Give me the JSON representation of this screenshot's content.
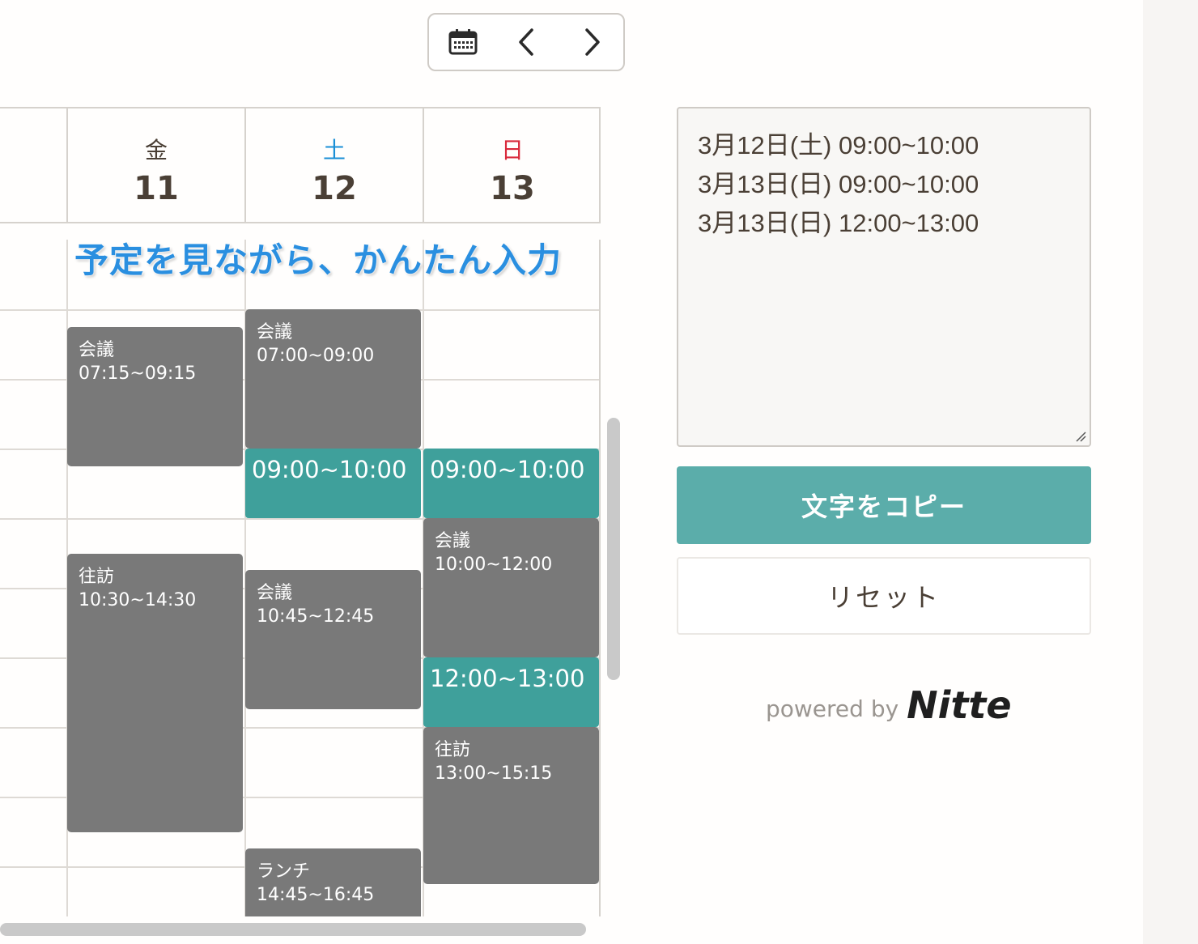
{
  "toolbar": {
    "calendar_icon": "calendar-icon",
    "prev_icon": "chevron-left-icon",
    "next_icon": "chevron-right-icon"
  },
  "days": [
    {
      "dow": "金",
      "date": "11",
      "color": "#4a3f35"
    },
    {
      "dow": "土",
      "date": "12",
      "color": "#1a8fd6"
    },
    {
      "dow": "日",
      "date": "13",
      "color": "#d9293b"
    }
  ],
  "banner": "予定を見ながら、かんたん入力",
  "events": {
    "fri_meeting": {
      "title": "会議",
      "time": "07:15~09:15"
    },
    "fri_visit": {
      "title": "往訪",
      "time": "10:30~14:30"
    },
    "sat_meeting1": {
      "title": "会議",
      "time": "07:00~09:00"
    },
    "sat_meeting2": {
      "title": "会議",
      "time": "10:45~12:45"
    },
    "sat_lunch": {
      "title": "ランチ",
      "time": "14:45~16:45"
    },
    "sun_meeting": {
      "title": "会議",
      "time": "10:00~12:00"
    },
    "sun_visit": {
      "title": "往訪",
      "time": "13:00~15:15"
    }
  },
  "selected_slots": {
    "sat_slot": "09:00~10:00",
    "sun_slot1": "09:00~10:00",
    "sun_slot2": "12:00~13:00"
  },
  "colors": {
    "event": "#797979",
    "selected_slot": "#3fa09b",
    "copy_button": "#5badaa",
    "banner": "#2a8fe0"
  },
  "panel": {
    "text_lines": [
      "3月12日(土) 09:00~10:00",
      "3月13日(日) 09:00~10:00",
      "3月13日(日) 12:00~13:00"
    ],
    "copy_label": "文字をコピー",
    "reset_label": "リセット",
    "powered_by": "powered by",
    "brand": "Nitte"
  }
}
